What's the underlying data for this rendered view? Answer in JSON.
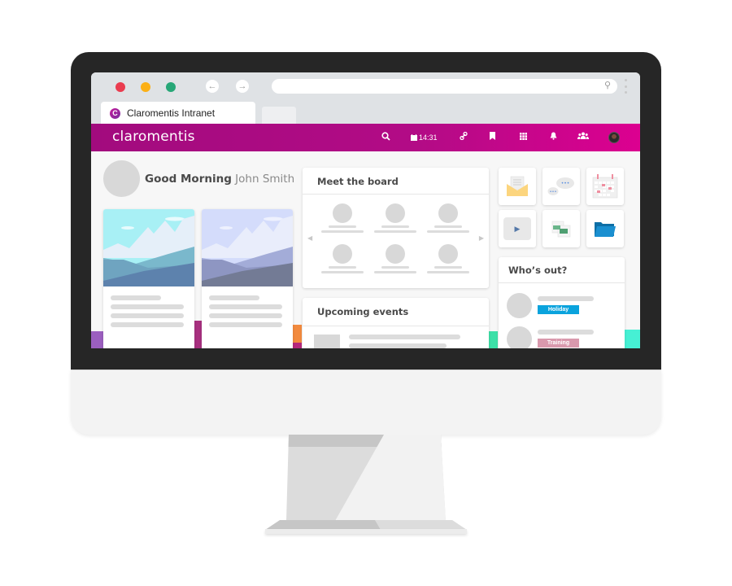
{
  "browser": {
    "tab_title": "Claromentis Intranet",
    "favicon_letter": "C",
    "nav_back_icon": "←",
    "nav_forward_icon": "→",
    "address_search_icon": "⚲"
  },
  "app": {
    "logo": "claromentis",
    "brand_colors": {
      "primary": "#a20b7e",
      "accent": "#dc0090"
    },
    "header": {
      "search_icon": "⚲",
      "clock_icon": "▦",
      "time": "14:31",
      "link_icon": "🔗",
      "bookmark_icon": "▮",
      "apps_icon": "▦",
      "bell_icon": "▲",
      "people_icon": "👥"
    }
  },
  "greeting": {
    "hello": "Good Morning",
    "name": "John Smith"
  },
  "panels": {
    "board": {
      "title": "Meet the board",
      "prev_icon": "◀",
      "next_icon": "▶"
    },
    "events": {
      "title": "Upcoming events"
    },
    "whos_out": {
      "title": "Who’s out?",
      "entries": [
        {
          "status": "Holiday",
          "color": "#0aa3dd"
        },
        {
          "status": "Training",
          "color": "#d999ad"
        }
      ]
    }
  },
  "tiles": [
    {
      "name": "mail"
    },
    {
      "name": "chat",
      "bubble_text": "•••"
    },
    {
      "name": "calendar"
    },
    {
      "name": "video",
      "play_icon": "▶"
    },
    {
      "name": "documents"
    },
    {
      "name": "folder"
    }
  ]
}
